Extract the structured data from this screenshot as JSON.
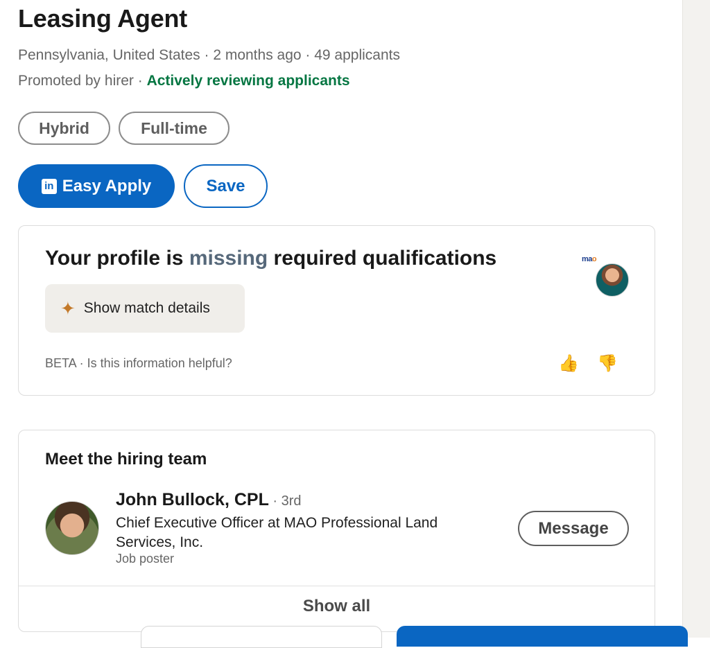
{
  "job": {
    "title": "Leasing Agent",
    "meta_line": "Pennsylvania, United States · 2 months ago · 49 applicants",
    "promoted": "Promoted by hirer · ",
    "status": "Actively reviewing applicants",
    "tags": [
      "Hybrid",
      "Full-time"
    ],
    "apply_label": "Easy Apply",
    "save_label": "Save",
    "apply_icon": "in"
  },
  "match_card": {
    "heading_pre": "Your profile is ",
    "heading_highlight": "missing",
    "heading_post": " required qualifications",
    "logo_text_a": "ma",
    "logo_text_b": "o",
    "show_match_label": "Show match details",
    "sparkle_glyph": "✦",
    "beta_text": "BETA · Is this information helpful?",
    "thumb_up_glyph": "👍",
    "thumb_down_glyph": "👎"
  },
  "hiring_team": {
    "heading": "Meet the hiring team",
    "person": {
      "name": "John Bullock, CPL",
      "degree": " · 3rd",
      "title": "Chief Executive Officer at MAO Professional Land Services, Inc.",
      "role": "Job poster"
    },
    "message_label": "Message",
    "show_all_label": "Show all"
  },
  "colors": {
    "brand_blue": "#0a66c2",
    "active_green": "#057642",
    "missing_slate": "#56687a"
  }
}
